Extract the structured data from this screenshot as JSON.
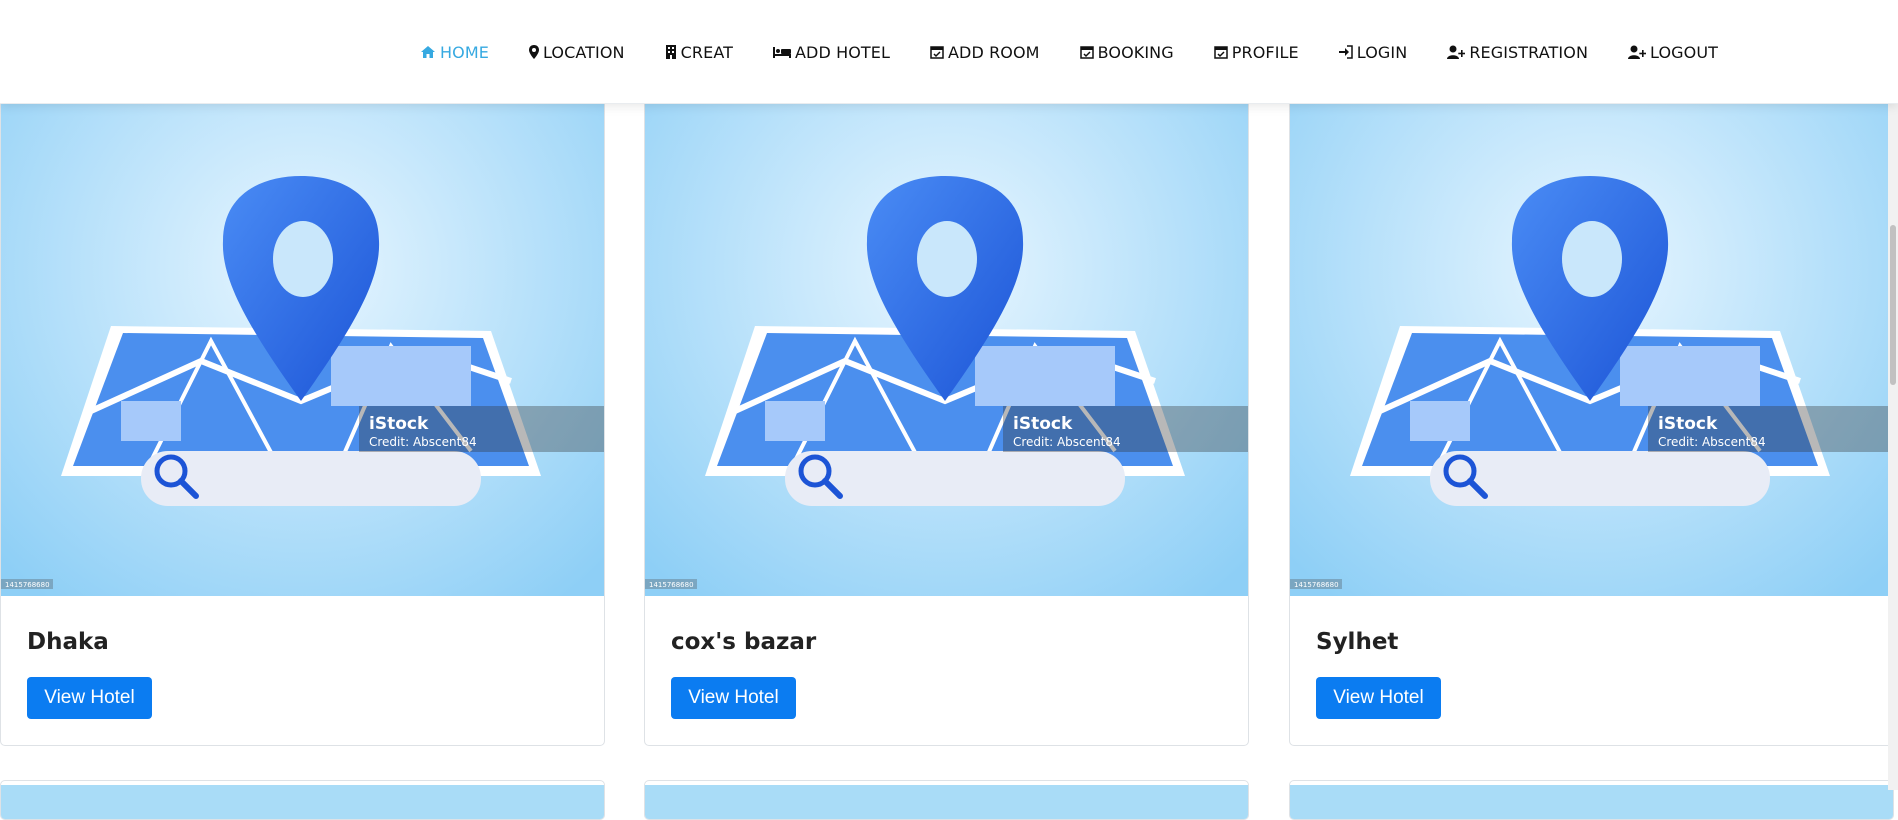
{
  "nav": {
    "items": [
      {
        "label": "HOME",
        "icon": "home-icon",
        "active": true
      },
      {
        "label": "LOCATION",
        "icon": "map-marker-icon",
        "active": false
      },
      {
        "label": "CREAT",
        "icon": "building-icon",
        "active": false
      },
      {
        "label": "ADD HOTEL",
        "icon": "bed-icon",
        "active": false
      },
      {
        "label": "ADD ROOM",
        "icon": "calendar-check-icon",
        "active": false
      },
      {
        "label": "BOOKING",
        "icon": "calendar-check-icon",
        "active": false
      },
      {
        "label": "PROFILE",
        "icon": "calendar-check-icon",
        "active": false
      },
      {
        "label": "LOGIN",
        "icon": "sign-in-icon",
        "active": false
      },
      {
        "label": "REGISTRATION",
        "icon": "user-plus-icon",
        "active": false
      },
      {
        "label": "LOGOUT",
        "icon": "user-plus-icon",
        "active": false
      }
    ],
    "active_color": "#36a9e1"
  },
  "cards": [
    {
      "title": "Dhaka",
      "button": "View Hotel"
    },
    {
      "title": "cox's bazar",
      "button": "View Hotel"
    },
    {
      "title": "Sylhet",
      "button": "View Hotel"
    }
  ],
  "image": {
    "watermark_brand": "iStock",
    "watermark_credit": "Credit: Abscent84",
    "stock_id": "1415768680"
  },
  "colors": {
    "button": "#0b7cf1",
    "pin": "#2f6ee8",
    "sky": "#a9dcf7"
  }
}
